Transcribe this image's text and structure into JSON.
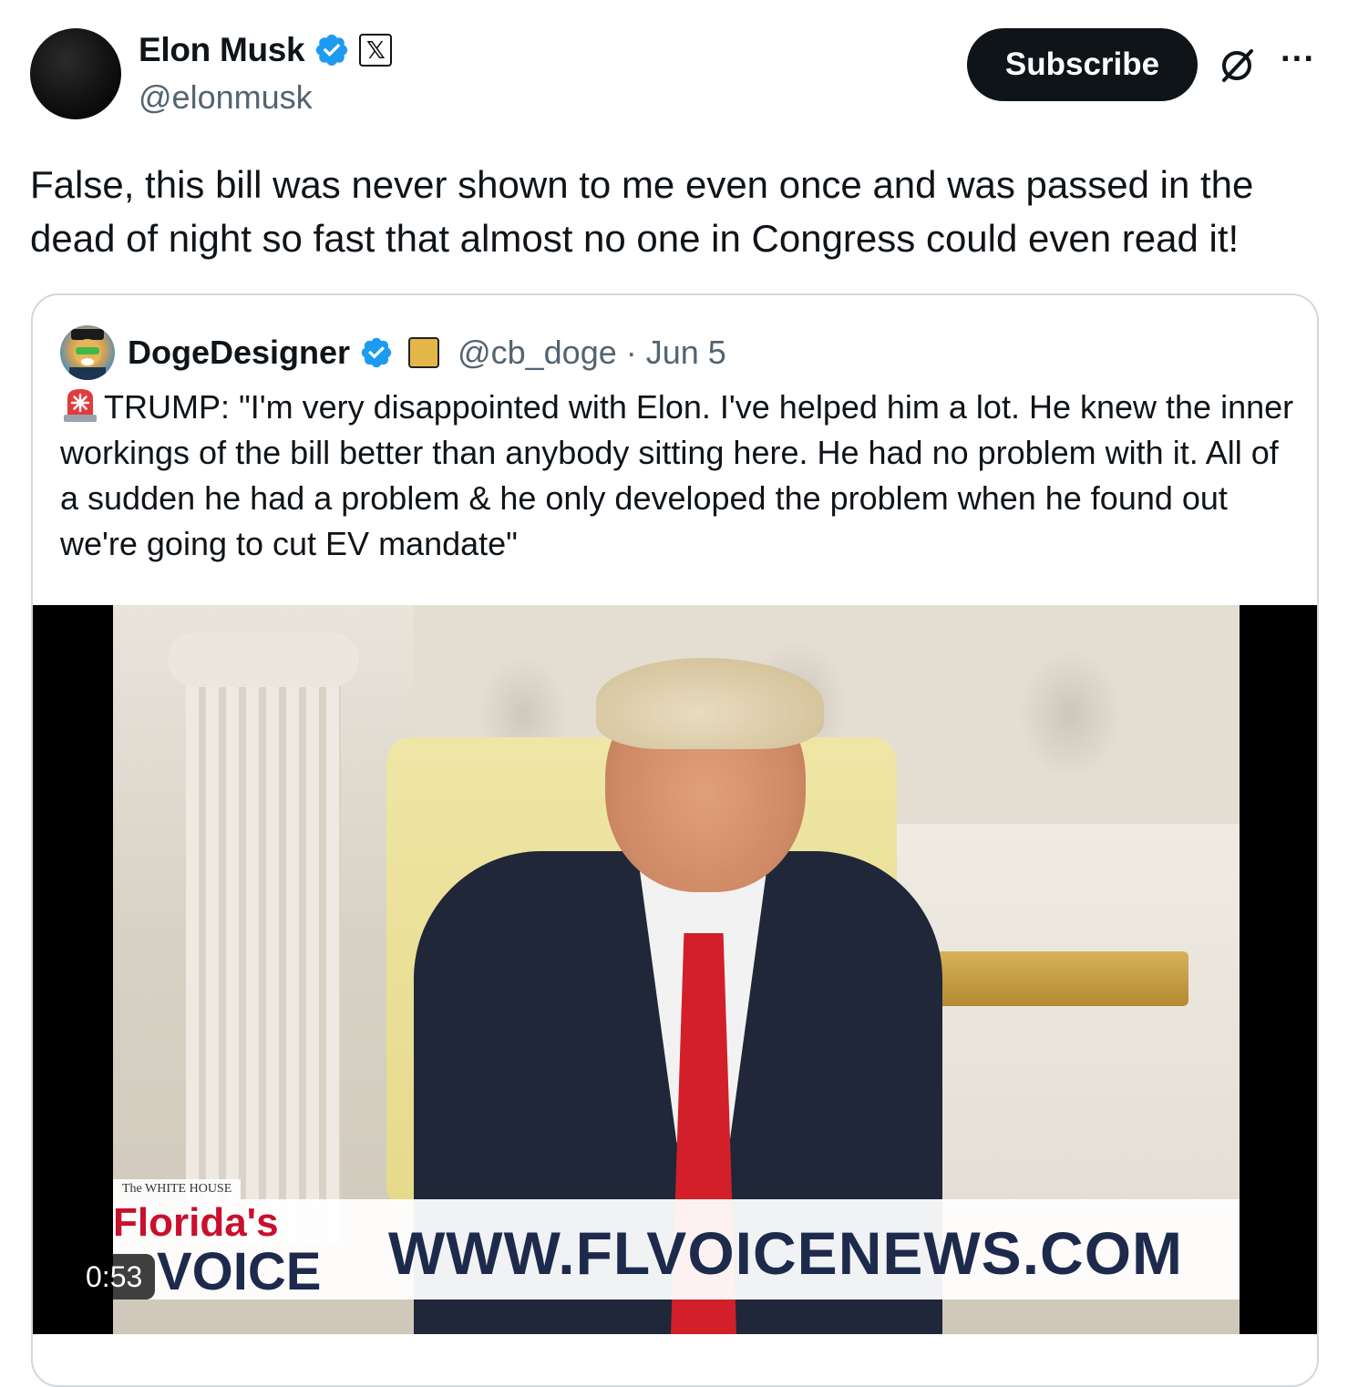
{
  "author": {
    "display_name": "Elon Musk",
    "handle": "@elonmusk",
    "affiliation_badge": "𝕏"
  },
  "header": {
    "subscribe_label": "Subscribe",
    "grok_icon": "grok-slash-circle-icon",
    "more_icon": "more-horizontal-icon",
    "more_glyph": "···"
  },
  "tweet": {
    "text": "False, this bill was never shown to me even once and was passed in the dead of night so fast that almost no one in Congress could even read it!"
  },
  "quoted_tweet": {
    "display_name": "DogeDesigner",
    "handle": "@cb_doge",
    "separator": " · ",
    "date": "Jun 5",
    "emoji_icon": "siren-icon",
    "text": "TRUMP: \"I'm very disappointed with Elon. I've helped him a lot. He knew the inner workings of the bill better than anybody sitting here. He had no problem with it. All of a sudden he had a problem & he only developed the problem when he found out we're going to cut EV mandate\"",
    "media": {
      "duration": "0:53",
      "overlay_small": "The WHITE HOUSE",
      "overlay_brand_line1": "Florida's",
      "overlay_brand_line2": "VOICE",
      "overlay_url": "WWW.FLVOICENEWS.COM"
    }
  },
  "colors": {
    "verified_blue": "#1d9bf0",
    "text_primary": "#0f1419",
    "text_secondary": "#536471",
    "border": "#cfd9de",
    "button_bg": "#0f1419"
  }
}
